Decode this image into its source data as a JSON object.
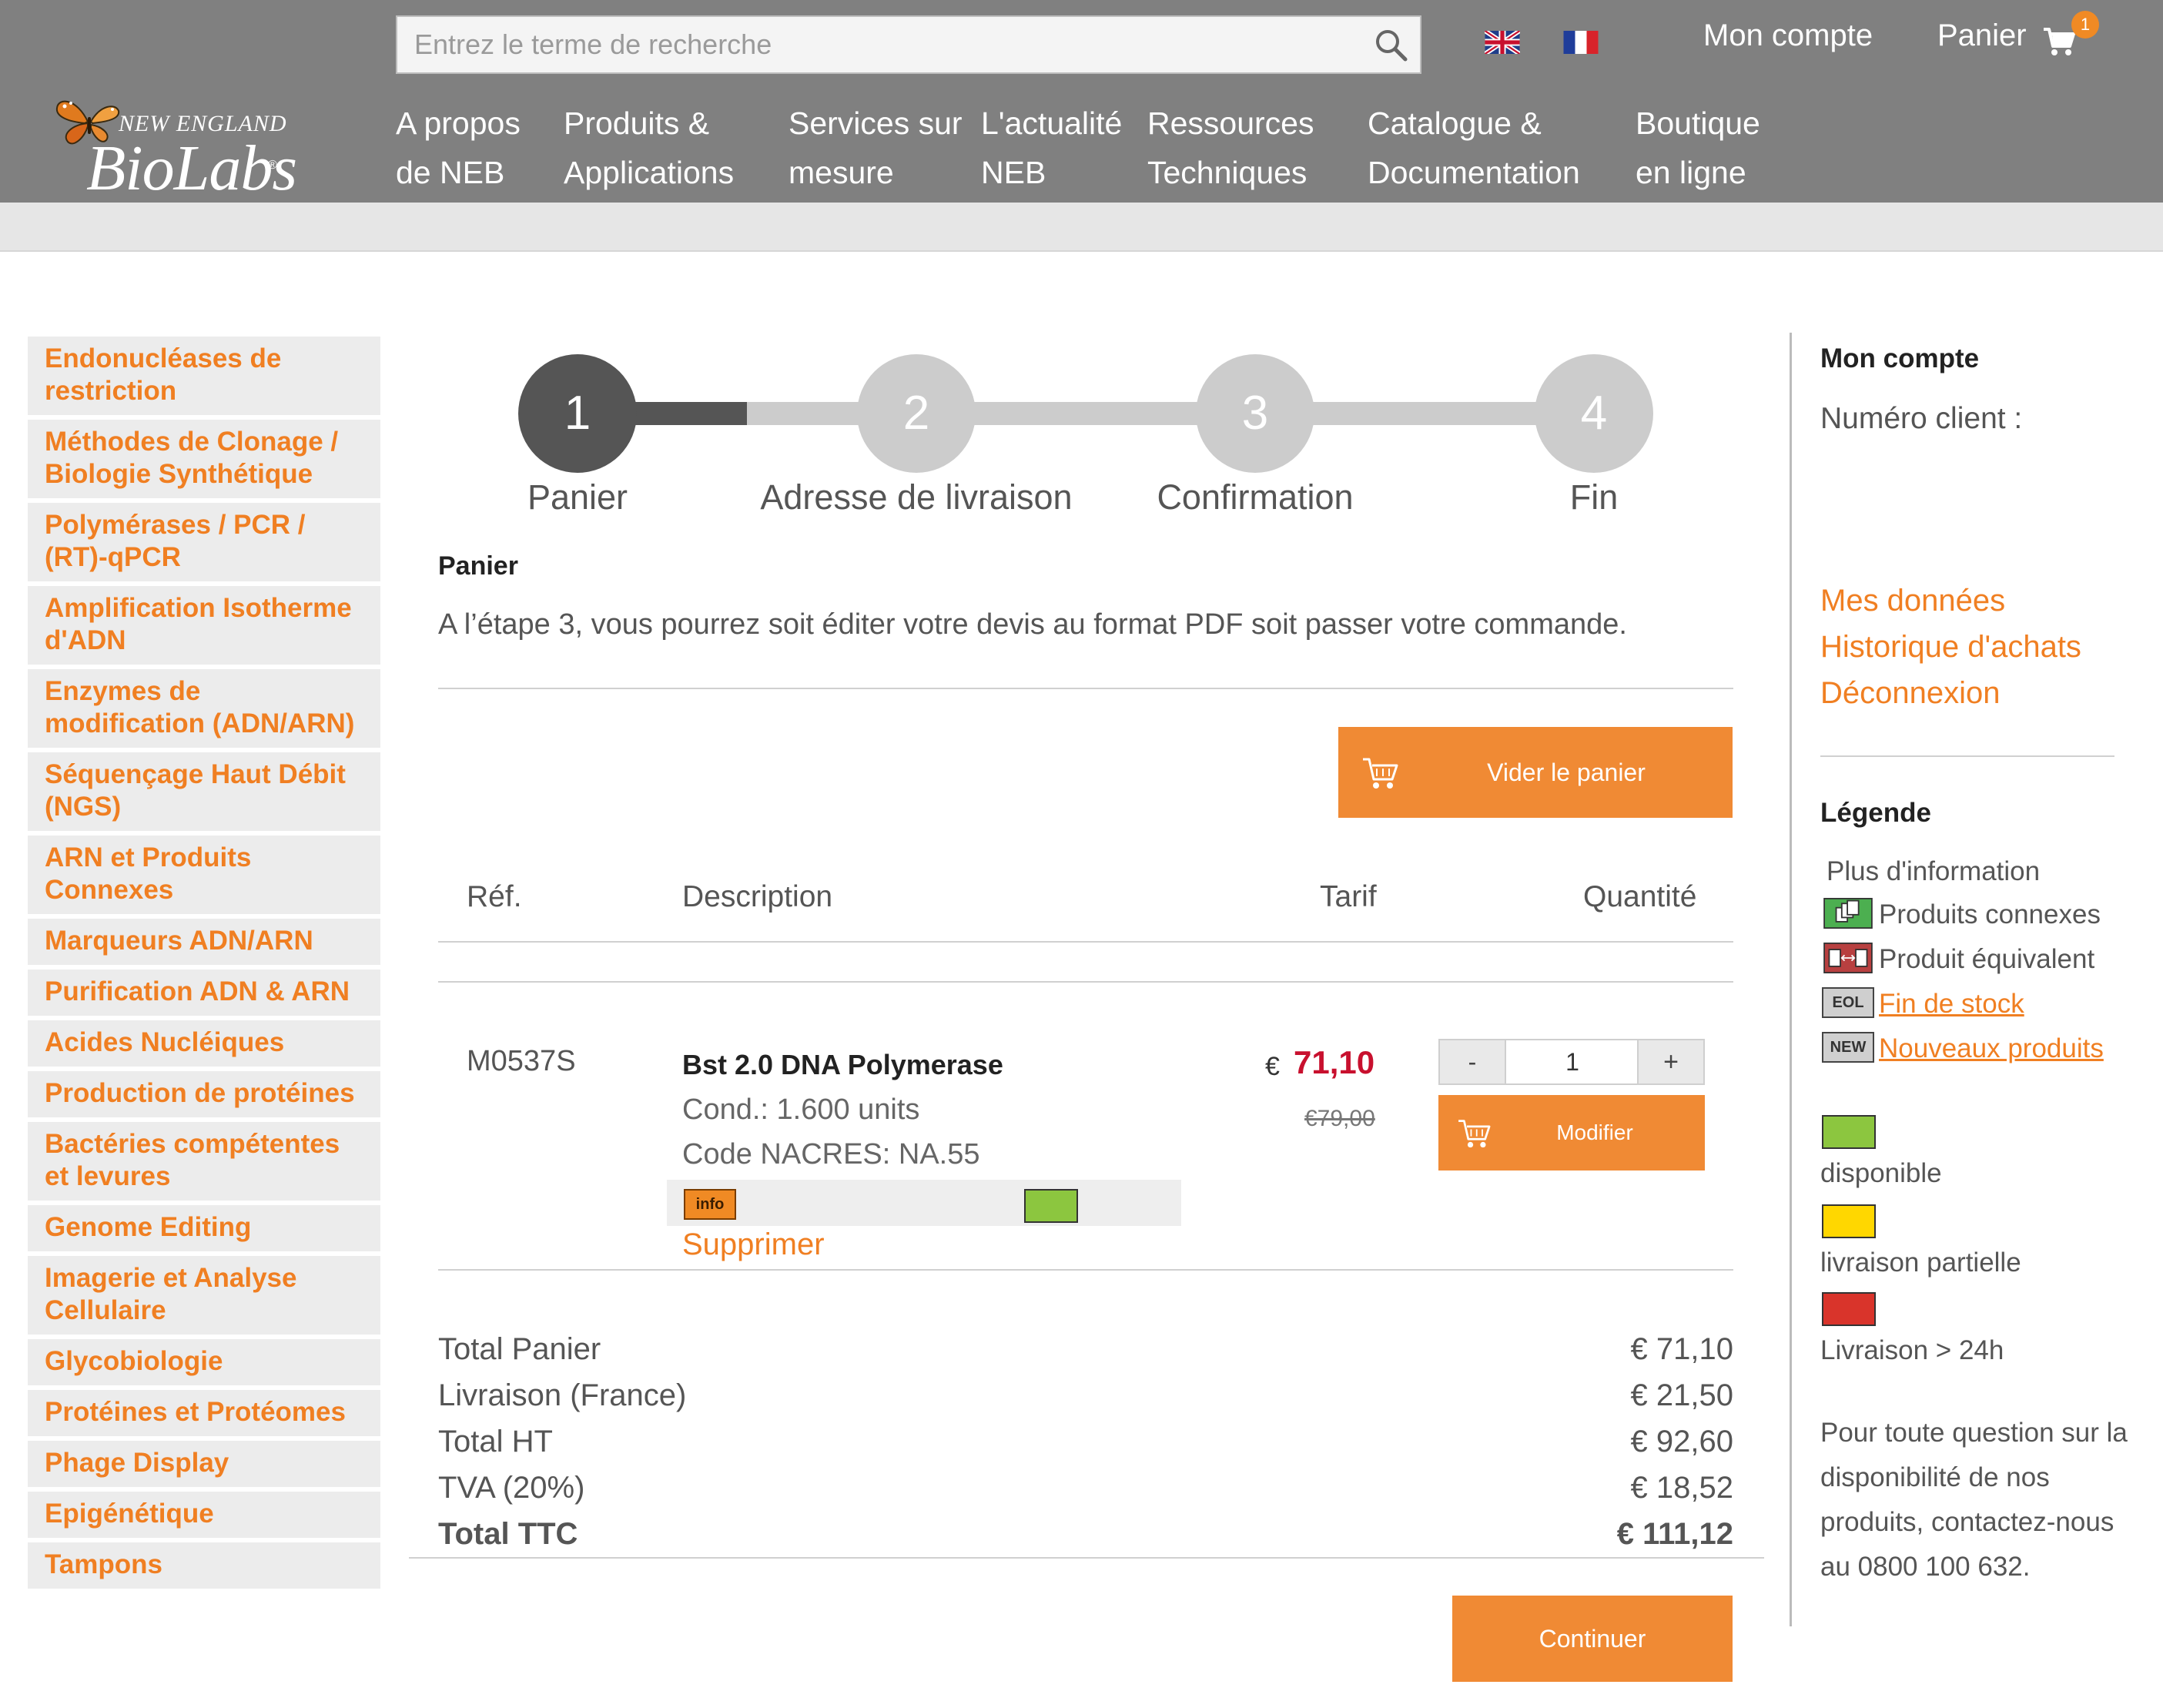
{
  "header": {
    "search": {
      "placeholder": "Entrez le terme de recherche",
      "icon": "search-icon"
    },
    "languages": [
      {
        "name": "english-flag"
      },
      {
        "name": "french-flag"
      }
    ],
    "account_label": "Mon compte",
    "cart_label": "Panier",
    "cart_count": "1",
    "logo": {
      "line1": "NEW ENGLAND",
      "line2": "BioLabs",
      "reg": "®"
    },
    "nav": [
      {
        "line1": "A propos",
        "line2": "de NEB"
      },
      {
        "line1": "Produits &",
        "line2": "Applications"
      },
      {
        "line1": "Services sur",
        "line2": "mesure"
      },
      {
        "line1": "L'actualité",
        "line2": "NEB"
      },
      {
        "line1": "Ressources",
        "line2": "Techniques"
      },
      {
        "line1": "Catalogue &",
        "line2": "Documentation"
      },
      {
        "line1": "Boutique",
        "line2": "en ligne"
      }
    ]
  },
  "sidebar": {
    "categories": [
      "Endonucléases de restriction",
      "Méthodes de Clonage / Biologie Synthétique",
      "Polymérases / PCR / (RT)-qPCR",
      "Amplification Isotherme d'ADN",
      "Enzymes de modification (ADN/ARN)",
      "Séquençage Haut Débit (NGS)",
      "ARN et Produits Connexes",
      "Marqueurs ADN/ARN",
      "Purification ADN & ARN",
      "Acides Nucléiques",
      "Production de protéines",
      "Bactéries compétentes et levures",
      "Genome Editing",
      "Imagerie et Analyse Cellulaire",
      "Glycobiologie",
      "Protéines et Protéomes",
      "Phage Display",
      "Epigénétique",
      "Tampons"
    ]
  },
  "steps": [
    {
      "num": "1",
      "label": "Panier",
      "active": true
    },
    {
      "num": "2",
      "label": "Adresse de livraison",
      "active": false
    },
    {
      "num": "3",
      "label": "Confirmation",
      "active": false
    },
    {
      "num": "4",
      "label": "Fin",
      "active": false
    }
  ],
  "cart": {
    "title": "Panier",
    "info": "A l’étape 3, vous pourrez soit éditer votre devis au format PDF soit passer votre commande.",
    "empty_button": "Vider le panier",
    "columns": {
      "ref": "Réf.",
      "description": "Description",
      "price": "Tarif",
      "quantity": "Quantité"
    },
    "item": {
      "ref": "M0537S",
      "name": "Bst 2.0 DNA Polymerase",
      "cond": "Cond.: 1.600 units",
      "nacres": "Code NACRES: NA.55",
      "info_icon": "info",
      "availability": "disponible",
      "delete": "Supprimer",
      "currency": "€",
      "price": "71,10",
      "old_price": "€79,00",
      "qty": "1",
      "minus": "-",
      "plus": "+",
      "modify": "Modifier"
    },
    "summary": [
      {
        "label": "Total Panier",
        "value": "€ 71,10"
      },
      {
        "label": "Livraison (France)",
        "value": "€ 21,50"
      },
      {
        "label": "Total HT",
        "value": "€ 92,60"
      },
      {
        "label": "TVA (20%)",
        "value": "€ 18,52"
      },
      {
        "label": "Total TTC",
        "value": "€ 111,12"
      }
    ],
    "continue_button": "Continuer"
  },
  "account": {
    "title": "Mon compte",
    "client_label": "Numéro client :",
    "links": [
      "Mes données",
      "Historique d'achats",
      "Déconnexion"
    ]
  },
  "legend": {
    "title": "Légende",
    "info": "Plus d'information",
    "items": [
      {
        "icon": "related-products-icon",
        "label": "Produits connexes",
        "link": false
      },
      {
        "icon": "equivalent-product-icon",
        "label": "Produit équivalent",
        "link": false
      },
      {
        "icon": "eol-icon",
        "icon_text": "EOL",
        "label": "Fin de stock",
        "link": true
      },
      {
        "icon": "new-icon",
        "icon_text": "NEW",
        "label": "Nouveaux produits",
        "link": true
      }
    ],
    "availability": [
      {
        "color": "#8cc63f",
        "label": "disponible"
      },
      {
        "color": "#ffd700",
        "label": "livraison partielle"
      },
      {
        "color": "#d9342b",
        "label": "Livraison > 24h"
      }
    ],
    "contact": "Pour toute question sur la disponibilité de nos produits, contactez-nous au 0800 100 632."
  },
  "colors": {
    "header_bg": "#808080",
    "accent": "#f08a34",
    "price_red": "#c8102e",
    "step_active": "#555555",
    "step_inactive": "#cccccc"
  }
}
